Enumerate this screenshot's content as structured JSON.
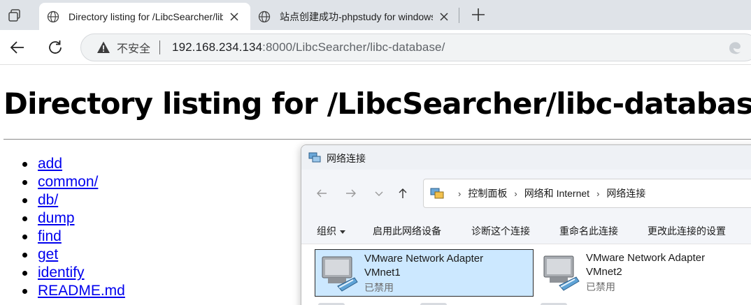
{
  "browser": {
    "tabs": [
      {
        "title": "Directory listing for /LibcSearcher/libc-database/",
        "active": true
      },
      {
        "title": "站点创建成功-phpstudy for windows",
        "active": false
      }
    ],
    "address": {
      "security_label": "不安全",
      "host": "192.168.234.134",
      "rest": ":8000/LibcSearcher/libc-database/"
    }
  },
  "page": {
    "heading": "Directory listing for /LibcSearcher/libc-database/",
    "entries": [
      "add",
      "common/",
      "db/",
      "dump",
      "find",
      "get",
      "identify",
      "README.md"
    ]
  },
  "explorer": {
    "title": "网络连接",
    "breadcrumb": [
      "控制面板",
      "网络和 Internet",
      "网络连接"
    ],
    "commands": {
      "organize": "组织",
      "enable": "启用此网络设备",
      "diagnose": "诊断这个连接",
      "rename": "重命名此连接",
      "change": "更改此连接的设置"
    },
    "adapters": [
      {
        "name": "VMware Network Adapter",
        "id": "VMnet1",
        "status": "已禁用",
        "selected": true
      },
      {
        "name": "VMware Network Adapter",
        "id": "VMnet2",
        "status": "已禁用",
        "selected": false
      }
    ]
  }
}
